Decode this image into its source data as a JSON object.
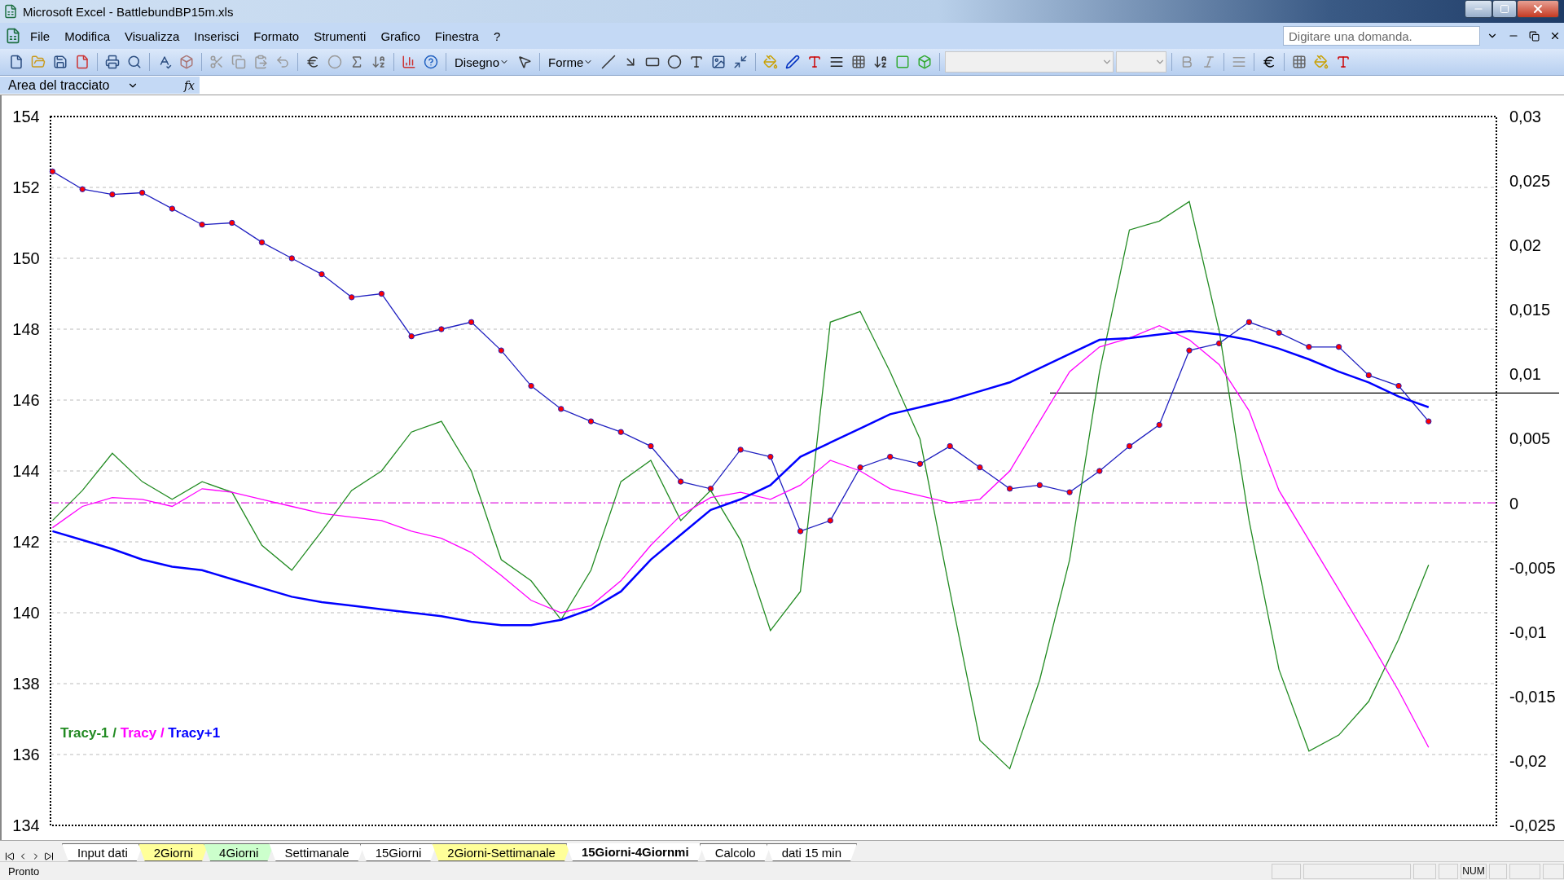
{
  "window": {
    "title": "Microsoft Excel - BattlebundBP15m.xls"
  },
  "menu": [
    "File",
    "Modifica",
    "Visualizza",
    "Inserisci",
    "Formato",
    "Strumenti",
    "Grafico",
    "Finestra",
    "?"
  ],
  "help_box": {
    "placeholder": "Digitare una domanda."
  },
  "toolbar": {
    "drawing_menus": [
      "Disegno",
      "Forme"
    ]
  },
  "formula_bar": {
    "name_box": "Area del tracciato",
    "function_button": "fx"
  },
  "chart": {
    "legend_separator": "/",
    "right_axis_ticks": [
      "0,03",
      "0,025",
      "0,02",
      "0,015",
      "0,01",
      "0,005",
      "0",
      "-0,005",
      "-0,01",
      "-0,015",
      "-0,02",
      "-0,025"
    ],
    "chart_data": {
      "type": "line",
      "grid": true,
      "ref_lines": [
        {
          "axis": "y",
          "value": 143.1,
          "color": "#e020e0"
        },
        {
          "axis": "y",
          "value": 146.2,
          "color": "#000000"
        }
      ],
      "ylim": [
        134,
        154
      ],
      "yticks": [
        134,
        136,
        138,
        140,
        142,
        144,
        146,
        148,
        150,
        152,
        154
      ],
      "series": [
        {
          "marker": true,
          "color": "#ff0000",
          "values": [
            152.45,
            151.95,
            151.8,
            151.85,
            151.4,
            150.95,
            151.0,
            150.45,
            150.0,
            149.55,
            148.9,
            149.0,
            147.8,
            148.0,
            148.2,
            147.4,
            146.4,
            145.75,
            145.4,
            145.1,
            144.7,
            143.7,
            143.5,
            144.6,
            144.4,
            142.3,
            142.6,
            144.1,
            144.4,
            144.2,
            144.7,
            144.1,
            143.5,
            143.6,
            143.4,
            144.0,
            144.7,
            145.3,
            147.4,
            147.6,
            148.2,
            147.9,
            147.5,
            147.5,
            146.7,
            146.4,
            145.4
          ]
        },
        {
          "name": "Tracy-1",
          "color": "#228b22",
          "values": [
            142.6,
            143.45,
            144.5,
            143.7,
            143.2,
            143.7,
            143.4,
            141.9,
            141.2,
            142.3,
            143.45,
            144.0,
            145.1,
            145.4,
            144.0,
            141.5,
            140.9,
            139.8,
            141.2,
            143.7,
            144.3,
            142.6,
            143.45,
            142.05,
            139.5,
            140.6,
            148.2,
            148.5,
            146.8,
            144.9,
            140.6,
            136.4,
            135.6,
            138.1,
            141.5,
            146.8,
            150.8,
            151.05,
            151.6,
            147.95,
            142.6,
            138.4,
            136.1,
            136.55,
            137.5,
            139.25,
            141.35
          ]
        },
        {
          "name": "Tracy",
          "color": "#ff00ff",
          "values": [
            142.4,
            143.0,
            143.25,
            143.2,
            143.0,
            143.5,
            143.4,
            143.2,
            143.0,
            142.8,
            142.7,
            142.6,
            142.3,
            142.1,
            141.7,
            141.05,
            140.35,
            140.0,
            140.2,
            140.9,
            141.9,
            142.75,
            143.25,
            143.4,
            143.2,
            143.6,
            144.3,
            144.0,
            143.5,
            143.3,
            143.1,
            143.2,
            144.0,
            145.4,
            146.8,
            147.5,
            147.75,
            148.1,
            147.7,
            147.0,
            145.7,
            143.45,
            142.05,
            140.65,
            139.25,
            137.8,
            136.2
          ]
        },
        {
          "name": "Tracy+1",
          "color": "#0000ff",
          "values": [
            142.3,
            142.05,
            141.8,
            141.5,
            141.3,
            141.2,
            140.95,
            140.7,
            140.45,
            140.3,
            140.2,
            140.1,
            140.0,
            139.9,
            139.75,
            139.65,
            139.65,
            139.8,
            140.1,
            140.6,
            141.5,
            142.2,
            142.9,
            143.2,
            143.6,
            144.4,
            144.8,
            145.2,
            145.6,
            145.8,
            146.0,
            146.25,
            146.5,
            146.9,
            147.3,
            147.7,
            147.75,
            147.85,
            147.95,
            147.85,
            147.7,
            147.45,
            147.15,
            146.8,
            146.5,
            146.1,
            145.8
          ]
        }
      ]
    }
  },
  "sheet_tabs": [
    {
      "label": "Input dati",
      "selected": false,
      "color": "#ffffff"
    },
    {
      "label": "2Giorni",
      "selected": false,
      "color": "#ffff99"
    },
    {
      "label": "4Giorni",
      "selected": false,
      "color": "#ccffcc"
    },
    {
      "label": "Settimanale",
      "selected": false,
      "color": "#ffffff"
    },
    {
      "label": "15Giorni",
      "selected": false,
      "color": "#ffffff"
    },
    {
      "label": "2Giorni-Settimanale",
      "selected": false,
      "color": "#ffff99"
    },
    {
      "label": "15Giorni-4Giornmi",
      "selected": true,
      "color": "#ffffff"
    },
    {
      "label": "Calcolo",
      "selected": false,
      "color": "#ffffff"
    },
    {
      "label": "dati 15 min",
      "selected": false,
      "color": "#ffffff"
    }
  ],
  "status_bar": {
    "text": "Pronto",
    "indicator": "NUM"
  }
}
